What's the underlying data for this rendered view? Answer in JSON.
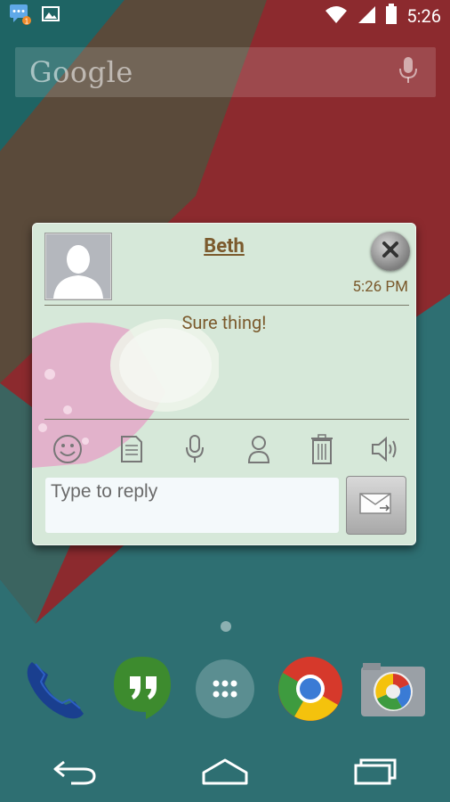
{
  "status_bar": {
    "time": "5:26",
    "icons": [
      "message-notification-icon",
      "gallery-icon",
      "wifi-icon",
      "signal-icon",
      "battery-icon"
    ]
  },
  "google_bar": {
    "logo_text": "Google",
    "icon": "microphone-icon"
  },
  "popup": {
    "contact_name": "Beth",
    "timestamp": "5:26 PM",
    "message": "Sure thing!",
    "toolbar": [
      "smiley-icon",
      "template-icon",
      "microphone-icon",
      "contact-icon",
      "trash-icon",
      "speaker-icon"
    ],
    "reply_placeholder": "Type to reply",
    "colors": {
      "panel": "#d6e8d9",
      "text": "#7b5a2d"
    }
  },
  "dock": [
    "phone-icon",
    "hangouts-icon",
    "app-drawer-icon",
    "chrome-icon",
    "camera-icon"
  ],
  "navbar": [
    "back-icon",
    "home-icon",
    "recents-icon"
  ]
}
